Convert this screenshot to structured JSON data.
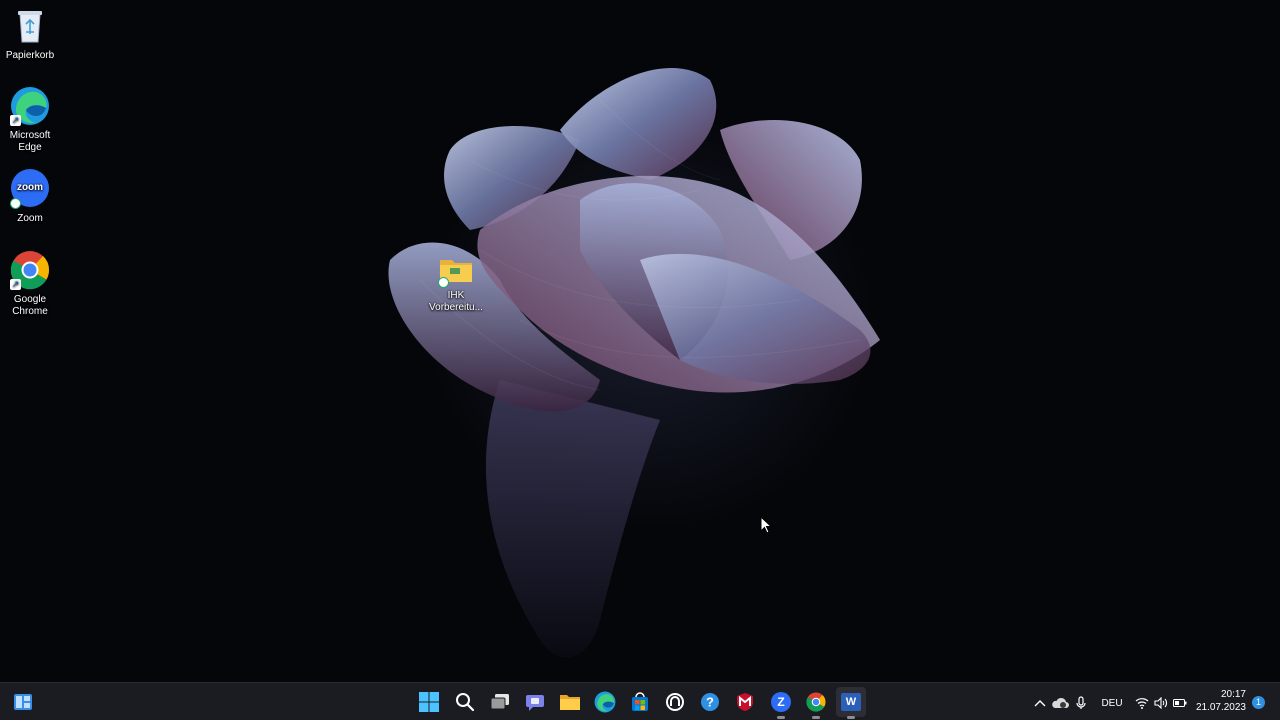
{
  "desktop": {
    "icons": [
      {
        "label": "Papierkorb"
      },
      {
        "label": "Microsoft Edge"
      },
      {
        "label": "Zoom",
        "glyph_text": "zoom"
      },
      {
        "label": "Google Chrome"
      },
      {
        "label": "IHK Vorbereitu..."
      }
    ]
  },
  "taskbar": {
    "left_icon": "widgets-icon",
    "pinned": [
      {
        "name": "start-icon"
      },
      {
        "name": "search-icon"
      },
      {
        "name": "task-view-icon"
      },
      {
        "name": "teams-chat-icon"
      },
      {
        "name": "file-explorer-icon"
      },
      {
        "name": "edge-icon"
      },
      {
        "name": "store-icon"
      },
      {
        "name": "app-icon"
      },
      {
        "name": "help-icon"
      },
      {
        "name": "mcafee-icon"
      },
      {
        "name": "zoom-icon",
        "glyph_text": "Z"
      },
      {
        "name": "chrome-icon"
      },
      {
        "name": "word-icon",
        "glyph_text": "W"
      }
    ]
  },
  "tray": {
    "language": "DEU",
    "time": "20:17",
    "date": "21.07.2023",
    "notification_count": "1"
  },
  "colors": {
    "taskbar_bg": "#1b1c22",
    "accent_blue": "#2f8fe0",
    "zoom_blue": "#2d6cf5",
    "mcafee_red": "#c8102e",
    "word_blue": "#2b5fb8"
  }
}
